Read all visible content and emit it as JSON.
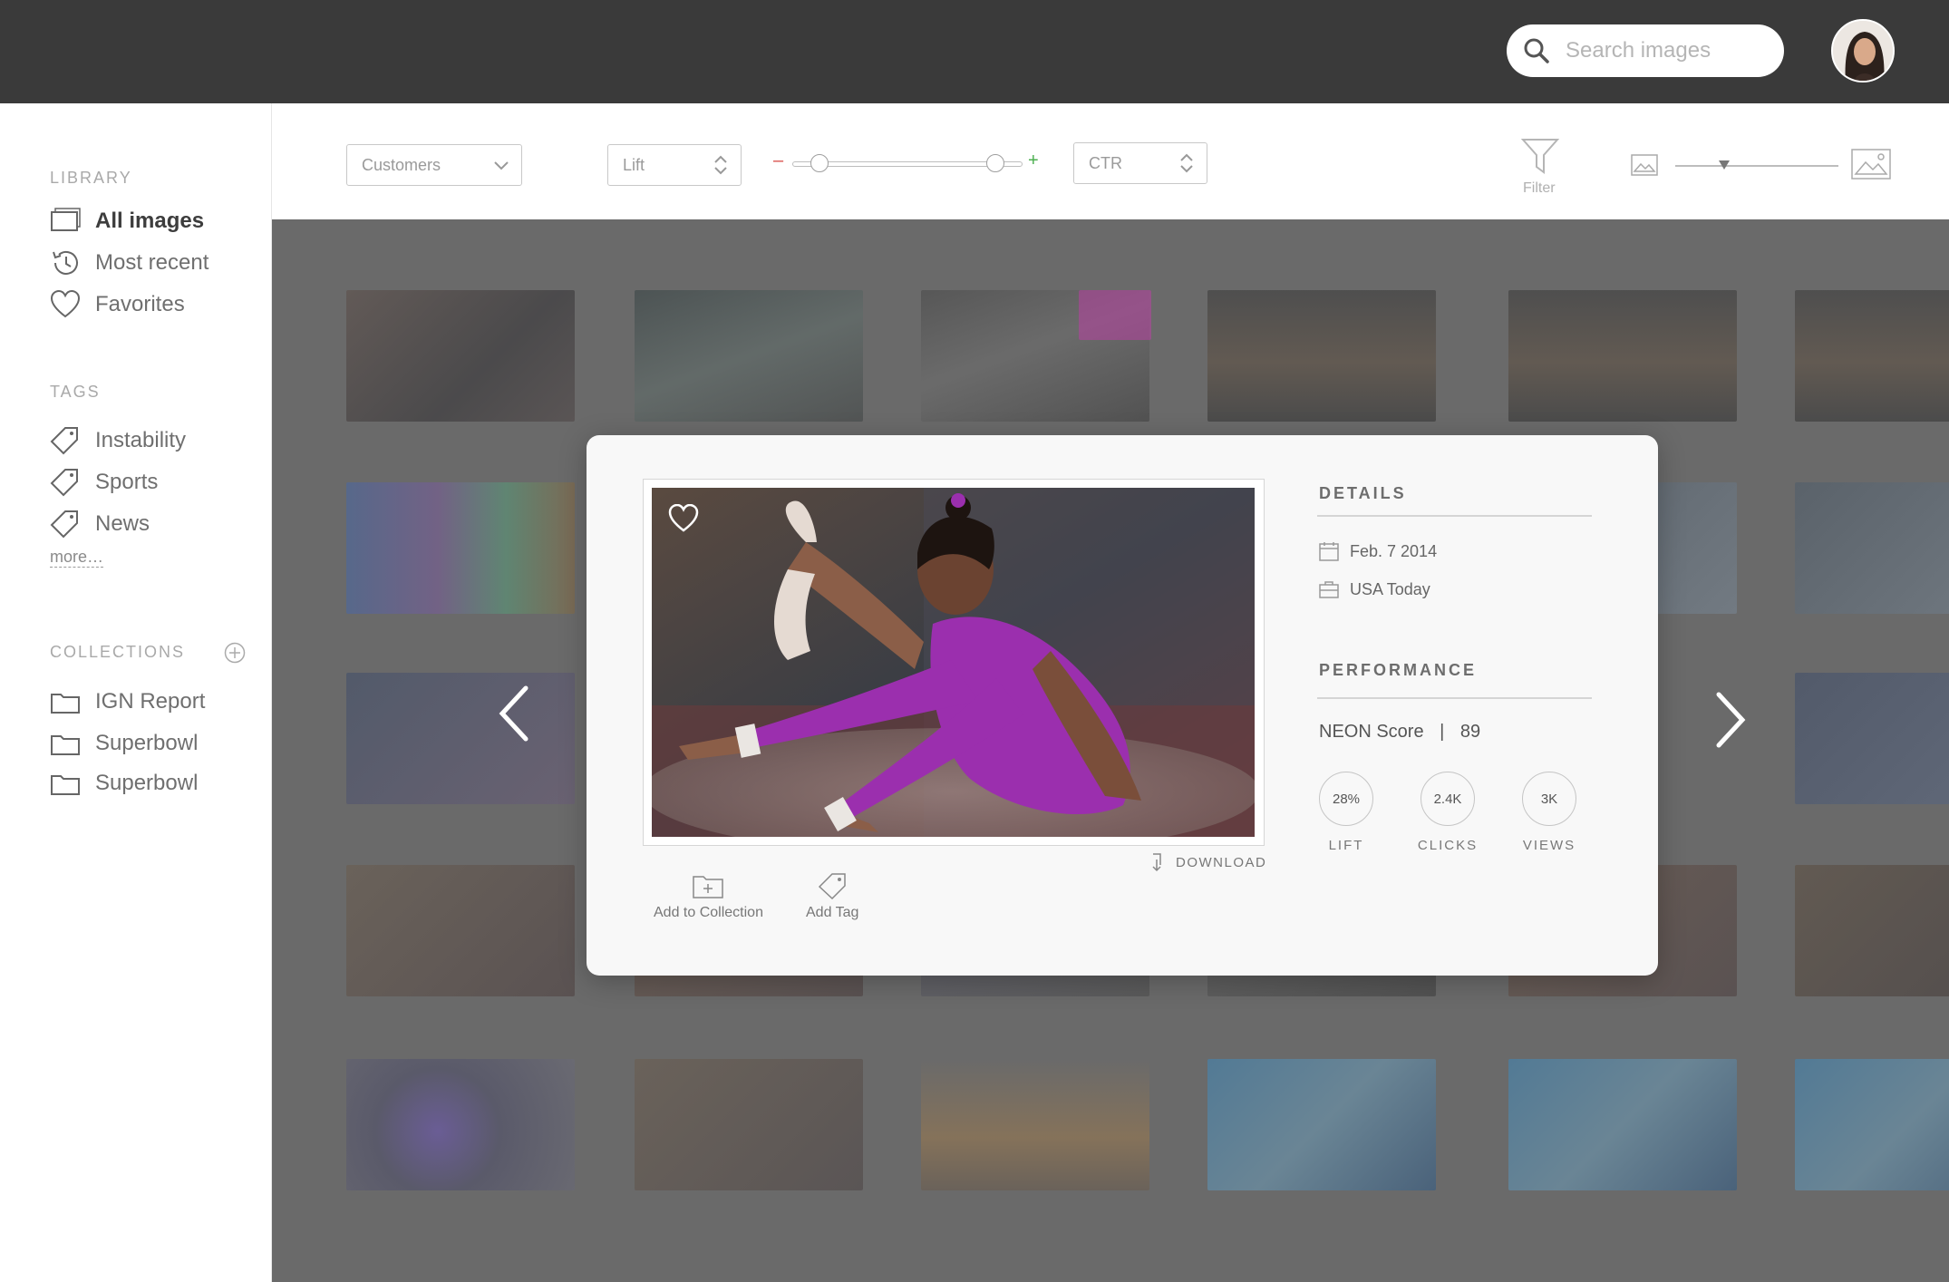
{
  "header": {
    "search_placeholder": "Search images",
    "icons": {
      "search": "search-icon",
      "avatar": "user-avatar"
    }
  },
  "sidebar": {
    "library_title": "LIBRARY",
    "library": [
      {
        "label": "All images",
        "icon": "images-icon",
        "active": true
      },
      {
        "label": "Most recent",
        "icon": "history-icon"
      },
      {
        "label": "Favorites",
        "icon": "heart-icon"
      }
    ],
    "tags_title": "TAGS",
    "tags": [
      {
        "label": "Instability",
        "icon": "tag-icon"
      },
      {
        "label": "Sports",
        "icon": "tag-icon"
      },
      {
        "label": "News",
        "icon": "tag-icon"
      }
    ],
    "more_label": "more…",
    "collections_title": "COLLECTIONS",
    "collections": [
      {
        "label": "IGN Report",
        "icon": "folder-icon"
      },
      {
        "label": "Superbowl",
        "icon": "folder-icon"
      },
      {
        "label": "Superbowl",
        "icon": "folder-icon"
      }
    ]
  },
  "toolbar": {
    "audience_select": "Customers",
    "metric_select": "Lift",
    "range_minus": "–",
    "range_plus": "+",
    "range_low": 0.12,
    "range_high": 0.88,
    "sort_select": "CTR",
    "filter_label": "Filter",
    "thumb_size": 0.3
  },
  "modal": {
    "details_title": "DETAILS",
    "date": "Feb. 7 2014",
    "source": "USA Today",
    "performance_title": "PERFORMANCE",
    "score_label": "NEON Score",
    "score_sep": "|",
    "score_value": "89",
    "metrics": [
      {
        "value": "28%",
        "label": "LIFT"
      },
      {
        "value": "2.4K",
        "label": "CLICKS"
      },
      {
        "value": "3K",
        "label": "VIEWS"
      }
    ],
    "download_label": "DOWNLOAD",
    "add_collection_label": "Add to Collection",
    "add_tag_label": "Add Tag",
    "colors": {
      "accent": "#9b2fae"
    }
  }
}
